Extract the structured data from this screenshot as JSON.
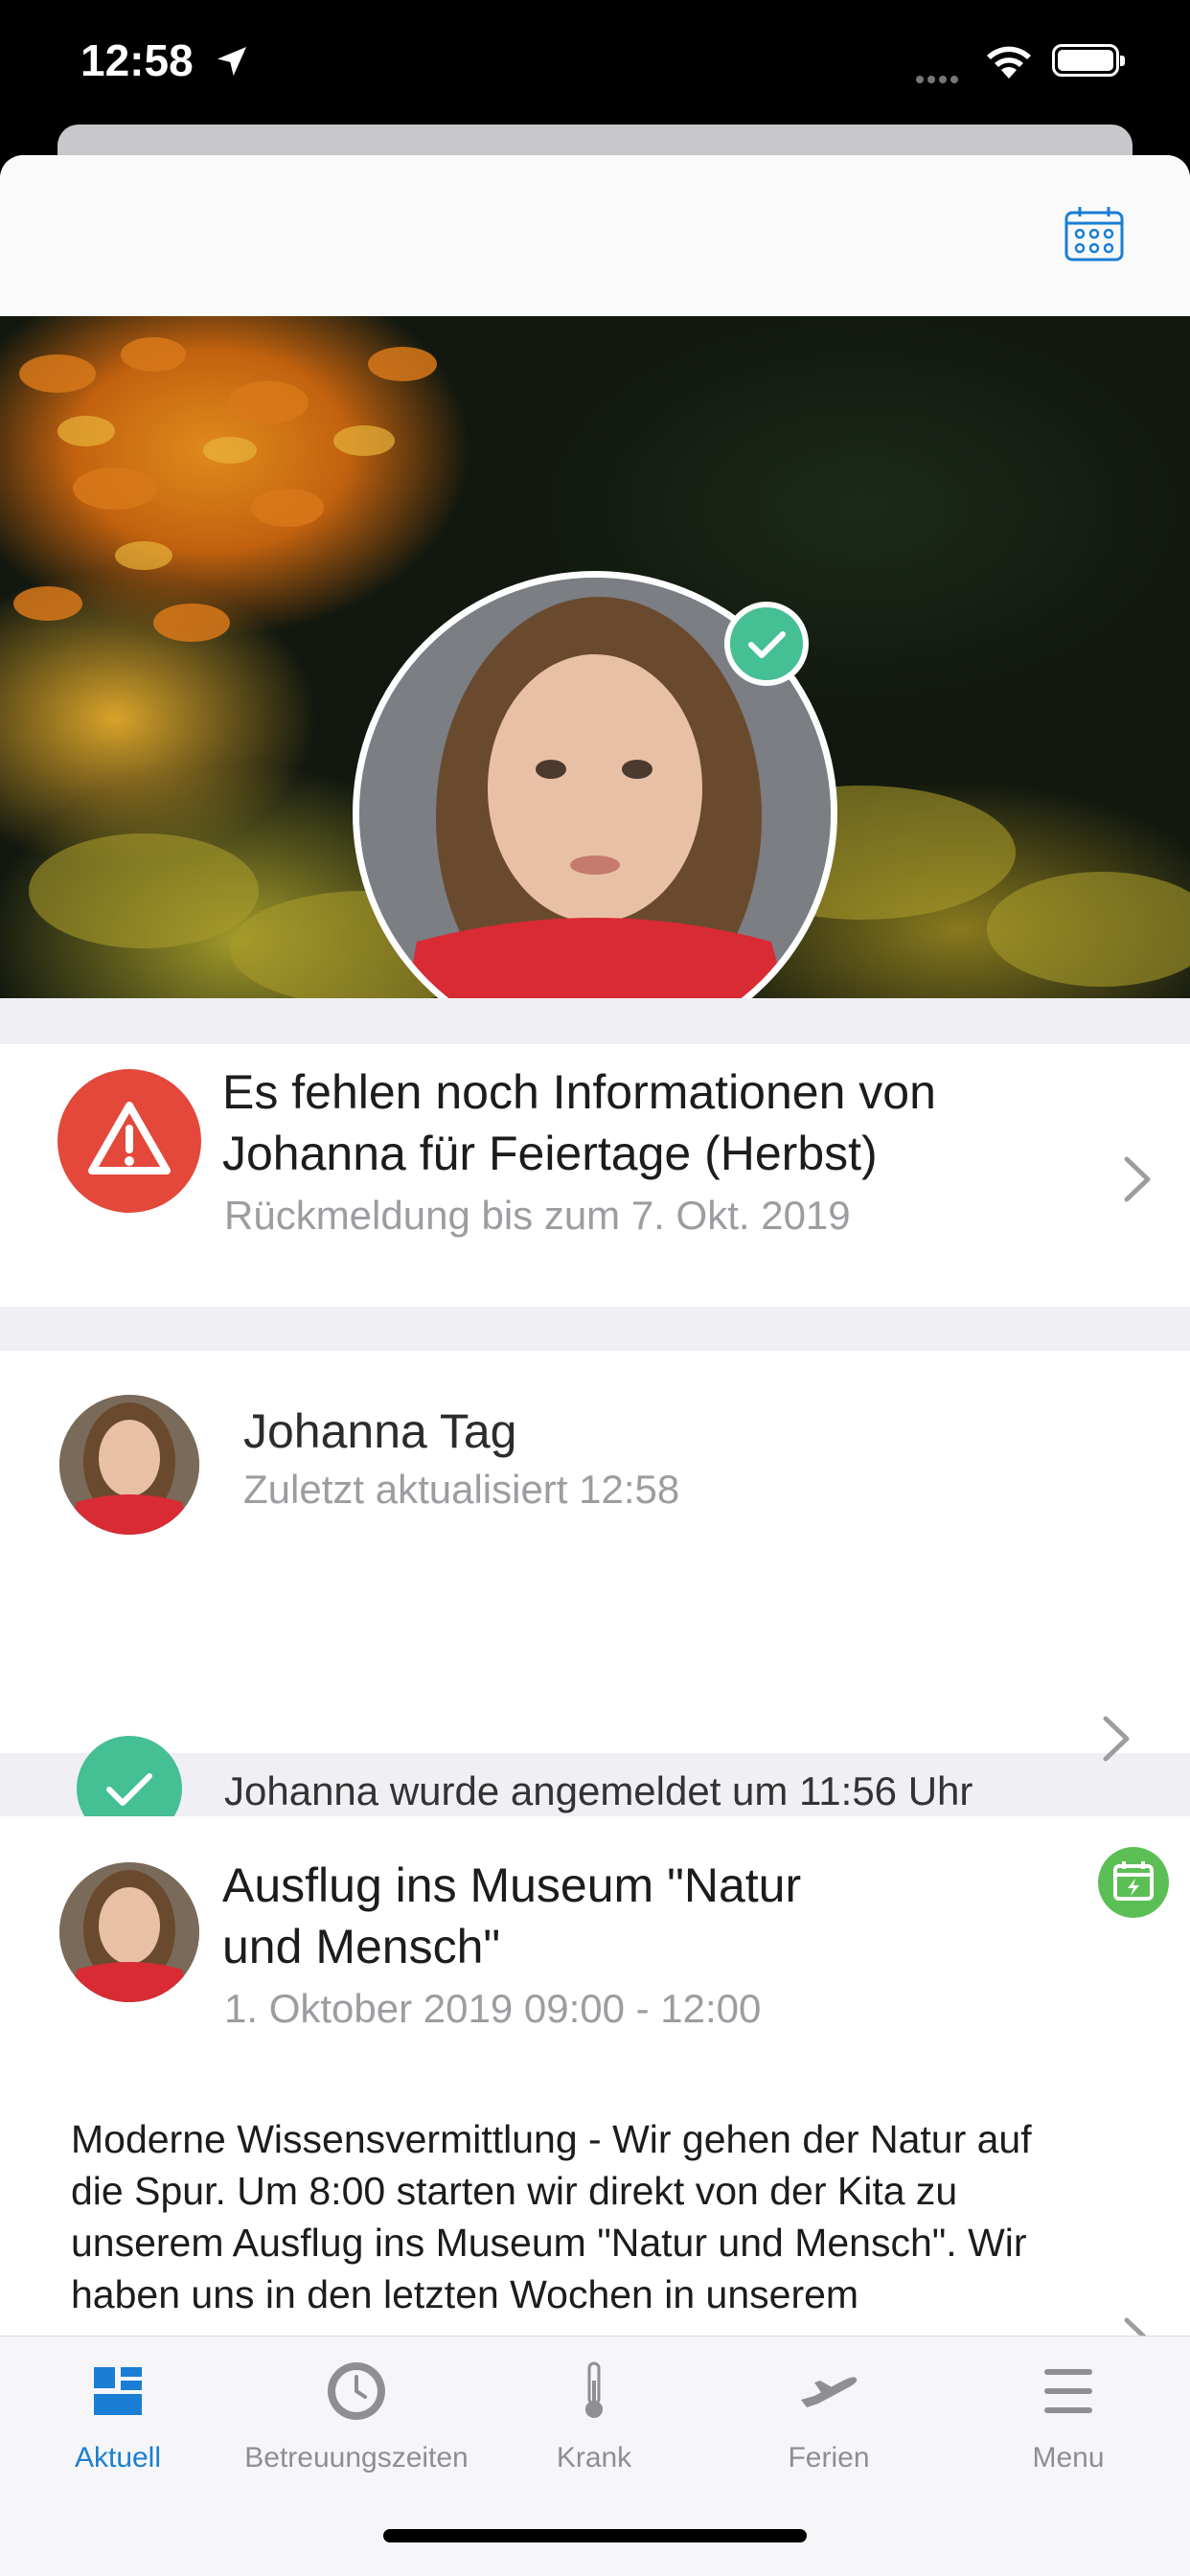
{
  "status_bar": {
    "time": "12:58"
  },
  "alert_card": {
    "title": "Es fehlen noch Informationen von Johanna für Feiertage (Herbst)",
    "title_line1": "Es fehlen noch Informationen von",
    "title_line2": "Johanna für Feiertage (Herbst)",
    "subtitle": "Rückmeldung bis zum 7. Okt. 2019"
  },
  "day_card": {
    "name": "Johanna Tag",
    "updated": "Zuletzt aktualisiert 12:58",
    "status": "Johanna wurde angemeldet um 11:56 Uhr"
  },
  "event_card": {
    "title_line1": "Ausflug ins Museum \"Natur",
    "title_line2": "und Mensch\"",
    "date": "1. Oktober 2019 09:00 - 12:00",
    "body": "Moderne Wissensvermittlung - Wir gehen der Natur auf die Spur. Um 8:00 starten wir direkt von der Kita zu unserem Ausflug ins Museum \"Natur und Mensch\". Wir haben uns in den letzten Wochen in unserem"
  },
  "tabs": [
    {
      "label": "Aktuell",
      "icon": "dashboard-icon",
      "active": true
    },
    {
      "label": "Betreuungszeiten",
      "icon": "clock-icon",
      "active": false
    },
    {
      "label": "Krank",
      "icon": "thermometer-icon",
      "active": false
    },
    {
      "label": "Ferien",
      "icon": "airplane-icon",
      "active": false
    },
    {
      "label": "Menu",
      "icon": "hamburger-menu-icon",
      "active": false
    }
  ],
  "colors": {
    "accent": "#1a7fd4",
    "alert": "#e3483b",
    "success": "#45bf94",
    "event": "#5cbf55",
    "inactive": "#8e8e93"
  }
}
